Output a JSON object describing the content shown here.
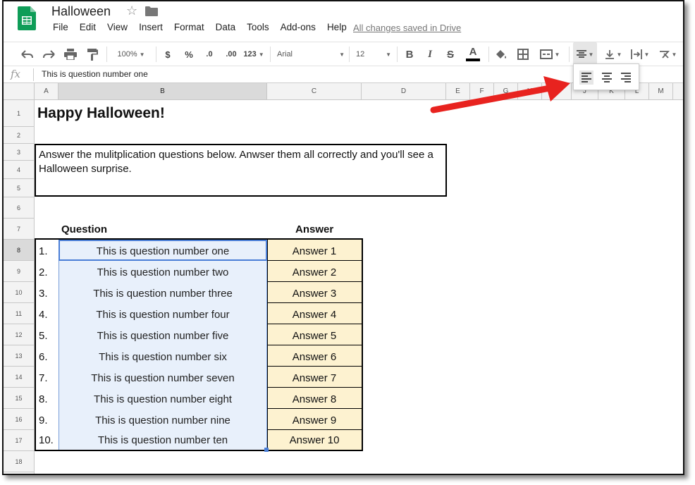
{
  "app": {
    "doc_title": "Halloween",
    "menu": [
      "File",
      "Edit",
      "View",
      "Insert",
      "Format",
      "Data",
      "Tools",
      "Add-ons",
      "Help"
    ],
    "save_status": "All changes saved in Drive"
  },
  "toolbar": {
    "zoom": "100%",
    "currency": "$",
    "percent": "%",
    "decimal_decrease": ".0",
    "decimal_increase": ".00",
    "more_formats": "123",
    "font": "Arial",
    "font_size": "12",
    "bold": "B",
    "italic": "I",
    "strike": "S",
    "text_color": "A"
  },
  "formula_bar": {
    "fx": "fx",
    "value": "This is question number one"
  },
  "columns": [
    "A",
    "B",
    "C",
    "D",
    "E",
    "F",
    "G",
    "H",
    "I",
    "J",
    "K",
    "L",
    "M"
  ],
  "rows": [
    "1",
    "2",
    "3",
    "4",
    "5",
    "6",
    "7",
    "8",
    "9",
    "10",
    "11",
    "12",
    "13",
    "14",
    "15",
    "16",
    "17",
    "18"
  ],
  "sheet": {
    "title": "Happy Halloween!",
    "instructions": "Answer the mulitplication questions below. Anwser them all correctly and you'll see a Halloween surprise.",
    "question_header": "Question",
    "answer_header": "Answer",
    "rows": [
      {
        "num": "1.",
        "question": "This is question number one",
        "answer": "Answer 1"
      },
      {
        "num": "2.",
        "question": "This is question number two",
        "answer": "Answer 2"
      },
      {
        "num": "3.",
        "question": "This is question number three",
        "answer": "Answer 3"
      },
      {
        "num": "4.",
        "question": "This is question number four",
        "answer": "Answer 4"
      },
      {
        "num": "5.",
        "question": "This is question number five",
        "answer": "Answer 5"
      },
      {
        "num": "6.",
        "question": "This is question number six",
        "answer": "Answer 6"
      },
      {
        "num": "7.",
        "question": "This is question number seven",
        "answer": "Answer 7"
      },
      {
        "num": "8.",
        "question": "This is question number eight",
        "answer": "Answer 8"
      },
      {
        "num": "9.",
        "question": "This is question number nine",
        "answer": "Answer 9"
      },
      {
        "num": "10.",
        "question": "This is question number ten",
        "answer": "Answer 10"
      }
    ]
  },
  "colors": {
    "accent_blue": "#4a7ed6",
    "question_fill": "#e8f0fb",
    "answer_fill": "#fdf2d0",
    "arrow_red": "#e8231f",
    "logo_green": "#0f9d58"
  }
}
